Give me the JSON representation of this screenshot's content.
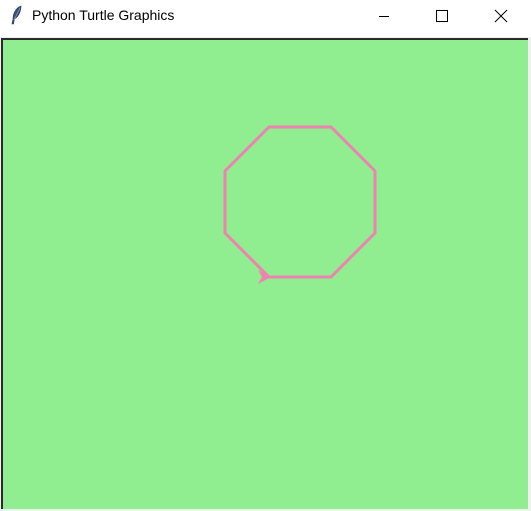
{
  "window": {
    "title": "Python Turtle Graphics"
  },
  "icons": {
    "app": "feather-icon",
    "minimize": "minimize-icon",
    "maximize": "maximize-icon",
    "close": "close-icon"
  },
  "canvas": {
    "background_color": "#90ee90",
    "pen_color": "#ee82b0",
    "shape": "octagon",
    "sides": 8
  }
}
